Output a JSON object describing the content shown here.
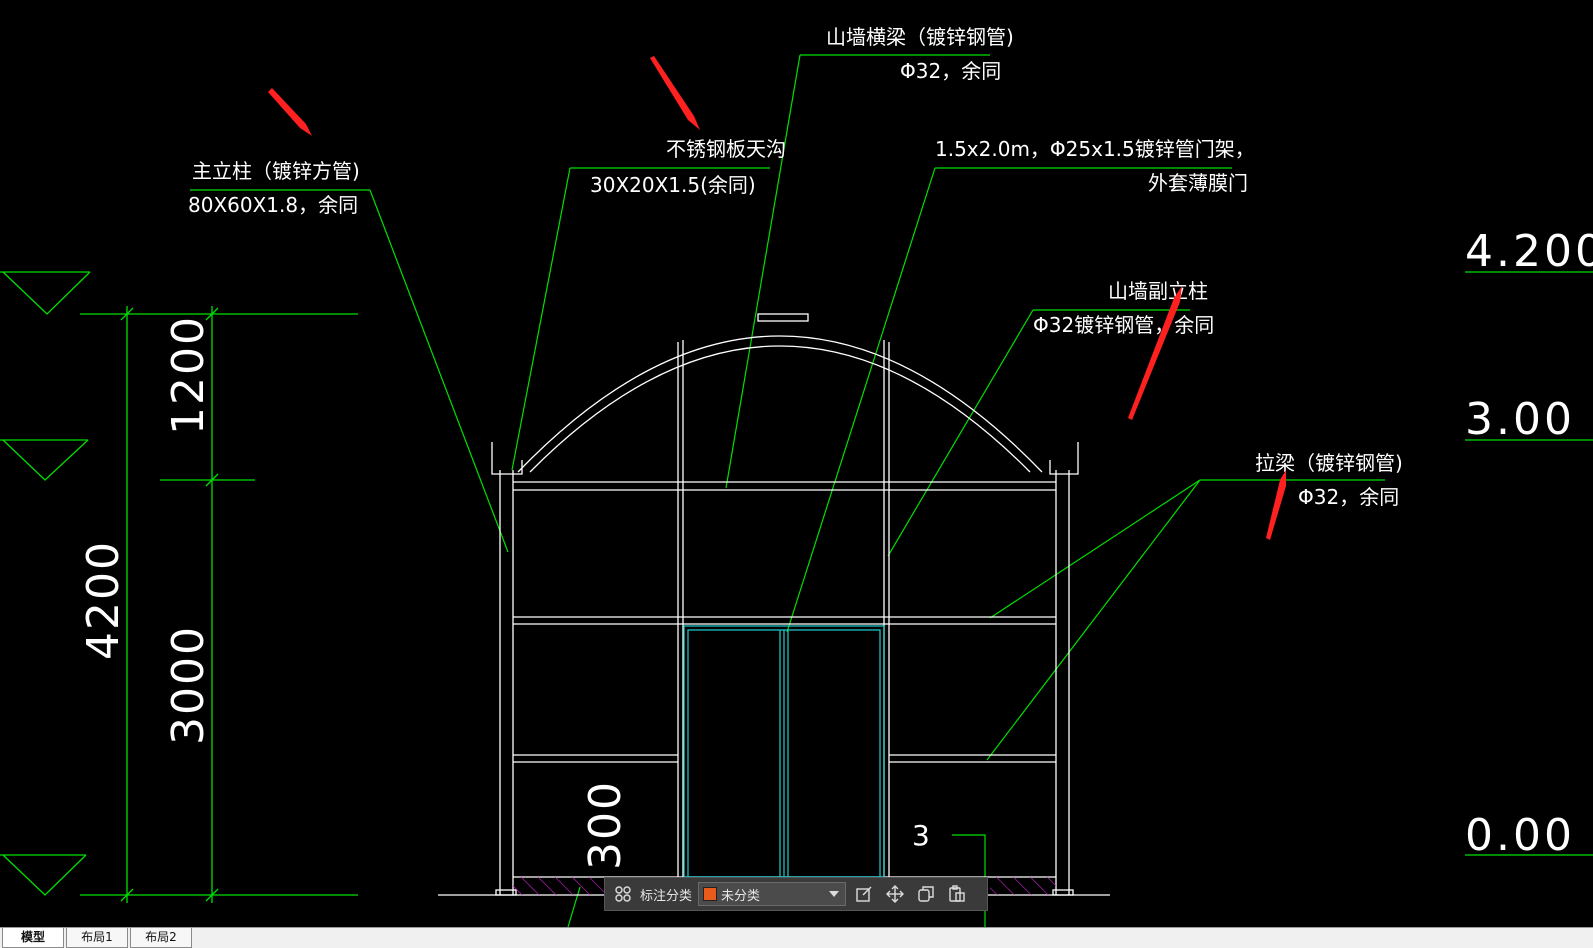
{
  "drawing": {
    "labels": {
      "gable_beam": "山墙横梁（镀锌钢管)",
      "gable_beam_spec": "Φ32，余同",
      "gutter": "不锈钢板天沟",
      "gutter_spec": "30X20X1.5(余同)",
      "main_column": "主立柱（镀锌方管)",
      "main_column_spec": "80X60X1.8，余同",
      "door": "1.5x2.0m，Φ25x1.5镀锌管门架，",
      "door_cover": "外套薄膜门",
      "gable_sub_column": "山墙副立柱",
      "gable_sub_column_spec": "Φ32镀锌钢管，余同",
      "tie_beam": "拉梁（镀锌钢管)",
      "tie_beam_spec": "Φ32，余同",
      "number_3": "3"
    },
    "dimensions": {
      "total": "4200",
      "upper": "1200",
      "lower": "3000",
      "base": "300"
    },
    "levels": {
      "top": "4.200",
      "mid": "3.00",
      "ground": "0.00"
    }
  },
  "toolbar": {
    "label": "标注分类",
    "category": "未分类",
    "category_color": "#e85b1a"
  },
  "tabs": [
    {
      "label": "模型"
    },
    {
      "label": "布局1"
    },
    {
      "label": "布局2"
    }
  ],
  "colors": {
    "background": "#000000",
    "leader": "#00e000",
    "structure": "#ffffff",
    "door": "#20d0d0",
    "hatch": "#c020c0",
    "annotation_arrow": "#ff2020"
  }
}
